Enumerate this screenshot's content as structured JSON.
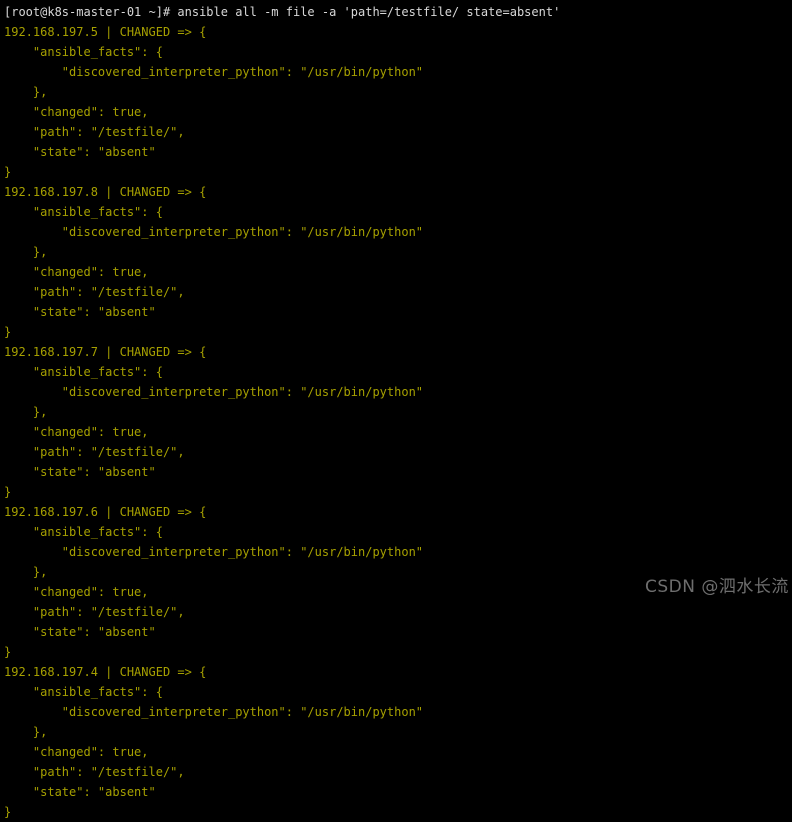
{
  "terminal": {
    "background_color": "#000000",
    "prompt_color": "#d8d8d8",
    "output_color": "#a6a000",
    "prompt_line": "[root@k8s-master-01 ~]# ansible all -m file -a 'path=/testfile/ state=absent'",
    "hostname": "k8s-master-01",
    "user": "root",
    "cwd": "~",
    "command": "ansible all -m file -a 'path=/testfile/ state=absent'",
    "lines": [
      "[root@k8s-master-01 ~]# ansible all -m file -a 'path=/testfile/ state=absent'",
      "192.168.197.5 | CHANGED => {",
      "    \"ansible_facts\": {",
      "        \"discovered_interpreter_python\": \"/usr/bin/python\"",
      "    },",
      "    \"changed\": true,",
      "    \"path\": \"/testfile/\",",
      "    \"state\": \"absent\"",
      "}",
      "192.168.197.8 | CHANGED => {",
      "    \"ansible_facts\": {",
      "        \"discovered_interpreter_python\": \"/usr/bin/python\"",
      "    },",
      "    \"changed\": true,",
      "    \"path\": \"/testfile/\",",
      "    \"state\": \"absent\"",
      "}",
      "192.168.197.7 | CHANGED => {",
      "    \"ansible_facts\": {",
      "        \"discovered_interpreter_python\": \"/usr/bin/python\"",
      "    },",
      "    \"changed\": true,",
      "    \"path\": \"/testfile/\",",
      "    \"state\": \"absent\"",
      "}",
      "192.168.197.6 | CHANGED => {",
      "    \"ansible_facts\": {",
      "        \"discovered_interpreter_python\": \"/usr/bin/python\"",
      "    },",
      "    \"changed\": true,",
      "    \"path\": \"/testfile/\",",
      "    \"state\": \"absent\"",
      "}",
      "192.168.197.4 | CHANGED => {",
      "    \"ansible_facts\": {",
      "        \"discovered_interpreter_python\": \"/usr/bin/python\"",
      "    },",
      "    \"changed\": true,",
      "    \"path\": \"/testfile/\",",
      "    \"state\": \"absent\"",
      "}"
    ],
    "hosts": [
      {
        "ip": "192.168.197.5",
        "status": "CHANGED",
        "discovered_interpreter_python": "/usr/bin/python",
        "changed": "true",
        "path": "/testfile/",
        "state": "absent"
      },
      {
        "ip": "192.168.197.8",
        "status": "CHANGED",
        "discovered_interpreter_python": "/usr/bin/python",
        "changed": "true",
        "path": "/testfile/",
        "state": "absent"
      },
      {
        "ip": "192.168.197.7",
        "status": "CHANGED",
        "discovered_interpreter_python": "/usr/bin/python",
        "changed": "true",
        "path": "/testfile/",
        "state": "absent"
      },
      {
        "ip": "192.168.197.6",
        "status": "CHANGED",
        "discovered_interpreter_python": "/usr/bin/python",
        "changed": "true",
        "path": "/testfile/",
        "state": "absent"
      },
      {
        "ip": "192.168.197.4",
        "status": "CHANGED",
        "discovered_interpreter_python": "/usr/bin/python",
        "changed": "true",
        "path": "/testfile/",
        "state": "absent"
      }
    ]
  },
  "watermark": {
    "text": "CSDN @泗水长流",
    "color": "#6e6e6e"
  }
}
